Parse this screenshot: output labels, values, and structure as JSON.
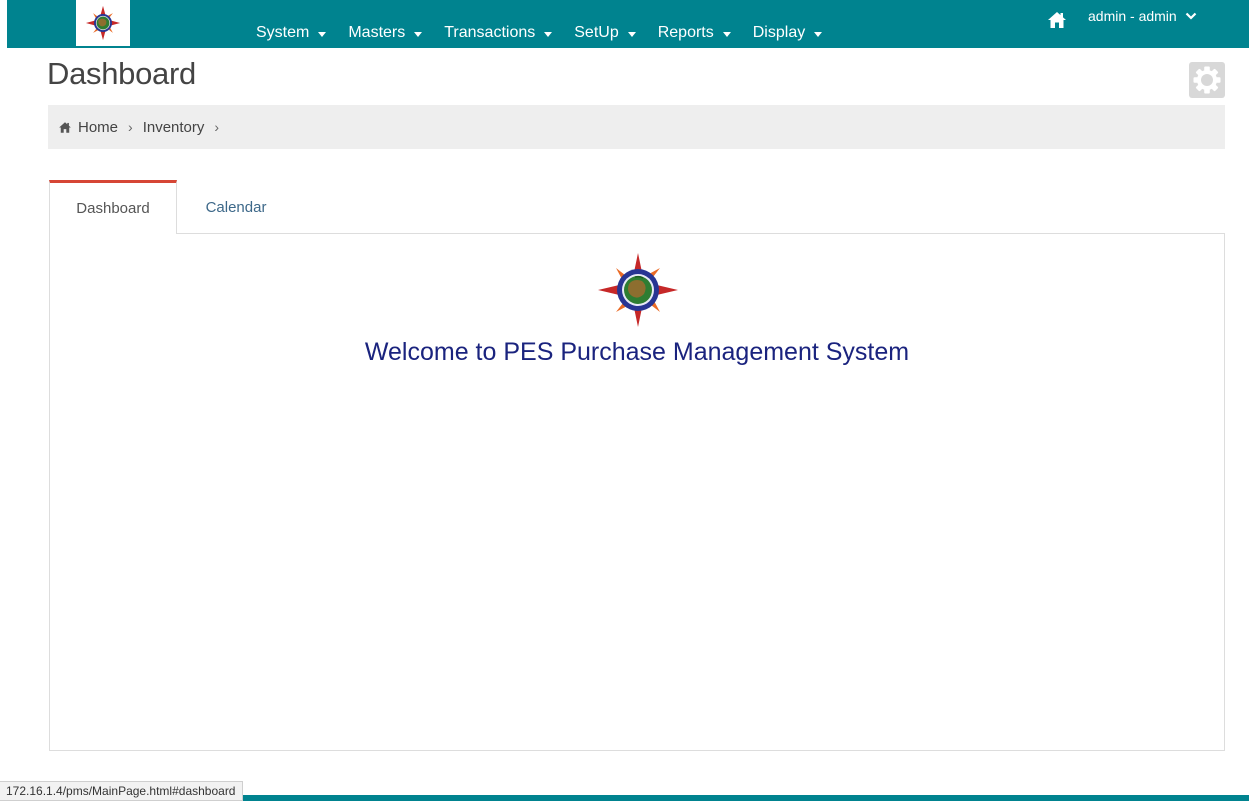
{
  "navbar": {
    "menu": [
      {
        "label": "System"
      },
      {
        "label": "Masters"
      },
      {
        "label": "Transactions"
      },
      {
        "label": "SetUp"
      },
      {
        "label": "Reports"
      },
      {
        "label": "Display"
      }
    ],
    "user_label": "admin - admin",
    "home_icon": "home-icon",
    "user_chevron_icon": "chevron-down-icon",
    "logo_icon": "compass-logo-icon"
  },
  "page": {
    "title": "Dashboard",
    "settings_icon": "gear-icon"
  },
  "breadcrumb": {
    "items": [
      {
        "label": "Home",
        "icon": "home-icon"
      },
      {
        "label": "Inventory"
      }
    ]
  },
  "tabs": [
    {
      "label": "Dashboard",
      "active": true
    },
    {
      "label": "Calendar",
      "active": false
    }
  ],
  "welcome": {
    "text": "Welcome to PES Purchase Management System"
  },
  "status_bar": {
    "url": "172.16.1.4/pms/MainPage.html#dashboard"
  },
  "colors": {
    "navbar": "#00838f",
    "active_tab_border": "#d64635",
    "welcome_text": "#1a237e",
    "tab_link": "#3d6889"
  }
}
